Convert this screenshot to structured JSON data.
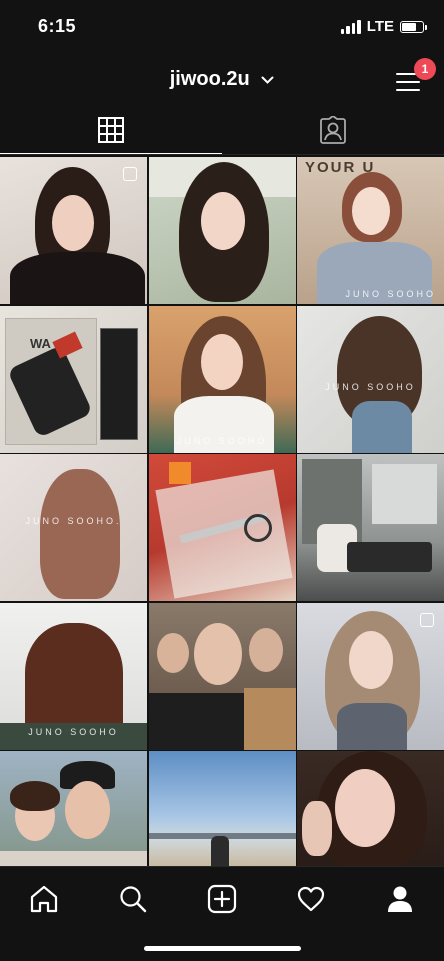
{
  "status_bar": {
    "time": "6:15",
    "network": "LTE",
    "battery_level": 0.75
  },
  "header": {
    "username": "jiwoo.2u",
    "notification_count": "1"
  },
  "tabs": [
    {
      "name": "grid",
      "icon": "grid-icon",
      "active": true
    },
    {
      "name": "tagged",
      "icon": "tagged-person-icon",
      "active": false
    }
  ],
  "posts": {
    "watermark_1": "JUNO SOOHO",
    "watermark_2": "JUNO SOOHO",
    "watermark_3": "JUNO SOOHO",
    "watermark_4": "JUNO SOOHO.",
    "watermark_5": "JUNO SOOHO",
    "clipper_box_text": "WA",
    "sign_text": "YOUR U"
  },
  "nav": [
    {
      "name": "home",
      "icon": "home-icon"
    },
    {
      "name": "search",
      "icon": "search-icon"
    },
    {
      "name": "new-post",
      "icon": "add-post-icon"
    },
    {
      "name": "activity",
      "icon": "heart-icon"
    },
    {
      "name": "profile",
      "icon": "profile-icon"
    }
  ],
  "colors": {
    "background": "#121212",
    "badge": "#ed4956",
    "text": "#ffffff"
  }
}
